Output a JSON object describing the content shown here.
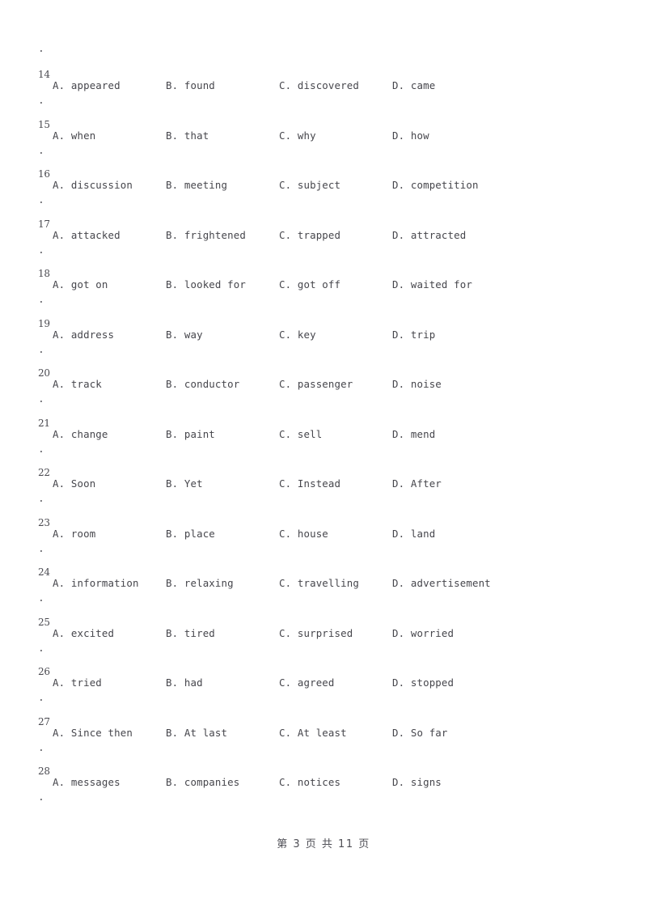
{
  "document": {
    "orphan_period": ".",
    "option_letters": [
      "A.",
      "B.",
      "C.",
      "D."
    ],
    "questions": [
      {
        "number": "14",
        "trailing_period": ".",
        "options": [
          "appeared",
          "found",
          "discovered",
          "came"
        ]
      },
      {
        "number": "15",
        "trailing_period": ".",
        "options": [
          "when",
          "that",
          "why",
          "how"
        ]
      },
      {
        "number": "16",
        "trailing_period": ".",
        "options": [
          "discussion",
          "meeting",
          "subject",
          "competition"
        ]
      },
      {
        "number": "17",
        "trailing_period": ".",
        "options": [
          "attacked",
          "frightened",
          "trapped",
          "attracted"
        ]
      },
      {
        "number": "18",
        "trailing_period": ".",
        "options": [
          "got on",
          "looked for",
          "got off",
          "waited for"
        ]
      },
      {
        "number": "19",
        "trailing_period": ".",
        "options": [
          "address",
          "way",
          "key",
          "trip"
        ]
      },
      {
        "number": "20",
        "trailing_period": ".",
        "options": [
          "track",
          "conductor",
          "passenger",
          "noise"
        ]
      },
      {
        "number": "21",
        "trailing_period": ".",
        "options": [
          "change",
          "paint",
          "sell",
          "mend"
        ]
      },
      {
        "number": "22",
        "trailing_period": ".",
        "options": [
          "Soon",
          "Yet",
          "Instead",
          "After"
        ]
      },
      {
        "number": "23",
        "trailing_period": ".",
        "options": [
          "room",
          "place",
          "house",
          "land"
        ]
      },
      {
        "number": "24",
        "trailing_period": ".",
        "options": [
          "information",
          "relaxing",
          "travelling",
          "advertisement"
        ]
      },
      {
        "number": "25",
        "trailing_period": ".",
        "options": [
          "excited",
          "tired",
          "surprised",
          "worried"
        ]
      },
      {
        "number": "26",
        "trailing_period": ".",
        "options": [
          "tried",
          "had",
          "agreed",
          "stopped"
        ]
      },
      {
        "number": "27",
        "trailing_period": ".",
        "options": [
          "Since then",
          "At last",
          "At least",
          "So far"
        ]
      },
      {
        "number": "28",
        "trailing_period": ".",
        "options": [
          "messages",
          "companies",
          "notices",
          "signs"
        ]
      }
    ]
  },
  "footer": {
    "page_text": "第 3 页 共 11 页",
    "current_page": "3",
    "total_pages": "11"
  },
  "colors": {
    "page_background": "#ffffff",
    "body_text": "#46464c",
    "number_text": "#4a4a50",
    "footer_text": "#4e4e55"
  }
}
